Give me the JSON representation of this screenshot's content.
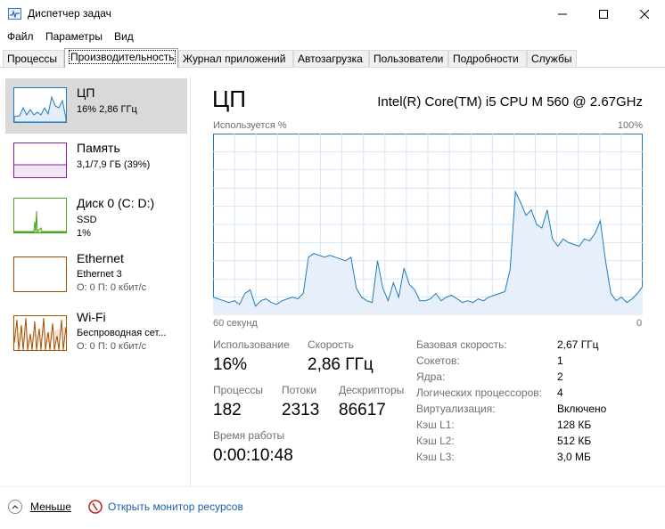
{
  "window": {
    "title": "Диспетчер задач",
    "minimize": "–",
    "maximize": "☐",
    "close": "✕"
  },
  "menu": [
    "Файл",
    "Параметры",
    "Вид"
  ],
  "tabs": [
    "Процессы",
    "Производительность",
    "Журнал приложений",
    "Автозагрузка",
    "Пользователи",
    "Подробности",
    "Службы"
  ],
  "sidebar": {
    "cpu": {
      "name": "ЦП",
      "sub1": "16% 2,86 ГГц"
    },
    "memory": {
      "name": "Память",
      "sub1": "3,1/7,9 ГБ (39%)"
    },
    "disk": {
      "name": "Диск 0 (C: D:)",
      "sub1": "SSD",
      "sub2": "1%"
    },
    "ethernet": {
      "name": "Ethernet",
      "sub1": "Ethernet 3",
      "sub2": "О: 0 П: 0 кбит/с"
    },
    "wifi": {
      "name": "Wi-Fi",
      "sub1": "Беспроводная сет...",
      "sub2": "О: 0 П: 0 кбит/с"
    },
    "colors": {
      "cpu": "#1e7bbf",
      "memory": "#8b1ea6",
      "disk": "#4ca31e",
      "network": "#a74f01"
    }
  },
  "main": {
    "title": "ЦП",
    "cpu_model": "Intel(R) Core(TM) i5 CPU M 560 @ 2.67GHz",
    "graph_label": "Используется %",
    "graph_max": "100%",
    "graph_time": "60 секунд",
    "graph_min": "0",
    "usage_label": "Использование",
    "usage_value": "16%",
    "speed_label": "Скорость",
    "speed_value": "2,86 ГГц",
    "processes_label": "Процессы",
    "processes_value": "182",
    "threads_label": "Потоки",
    "threads_value": "2313",
    "handles_label": "Дескрипторы",
    "handles_value": "86617",
    "uptime_label": "Время работы",
    "uptime_value": "0:00:10:48",
    "details": [
      {
        "label": "Базовая скорость:",
        "value": "2,67 ГГц"
      },
      {
        "label": "Сокетов:",
        "value": "1"
      },
      {
        "label": "Ядра:",
        "value": "2"
      },
      {
        "label": "Логических процессоров:",
        "value": "4"
      },
      {
        "label": "Виртуализация:",
        "value": "Включено"
      },
      {
        "label": "Кэш L1:",
        "value": "128 КБ"
      },
      {
        "label": "Кэш L2:",
        "value": "512 КБ"
      },
      {
        "label": "Кэш L3:",
        "value": "3,0 МБ"
      }
    ]
  },
  "bottom": {
    "less_label": "Меньше",
    "monitor_link": "Открыть монитор ресурсов"
  },
  "cpu_history": [
    10,
    9,
    8,
    7,
    8,
    6,
    12,
    14,
    5,
    8,
    9,
    7,
    6,
    8,
    9,
    10,
    9,
    12,
    32,
    34,
    33,
    32,
    33,
    32,
    31,
    30,
    32,
    15,
    10,
    8,
    7,
    30,
    15,
    8,
    18,
    10,
    26,
    17,
    14,
    8,
    8,
    9,
    12,
    8,
    10,
    11,
    9,
    7,
    8,
    7,
    9,
    8,
    10,
    11,
    12,
    13,
    25,
    68,
    62,
    55,
    58,
    50,
    48,
    58,
    42,
    38,
    42,
    40,
    39,
    38,
    42,
    41,
    45,
    52,
    30,
    12,
    8,
    10,
    7,
    9,
    12,
    16
  ]
}
